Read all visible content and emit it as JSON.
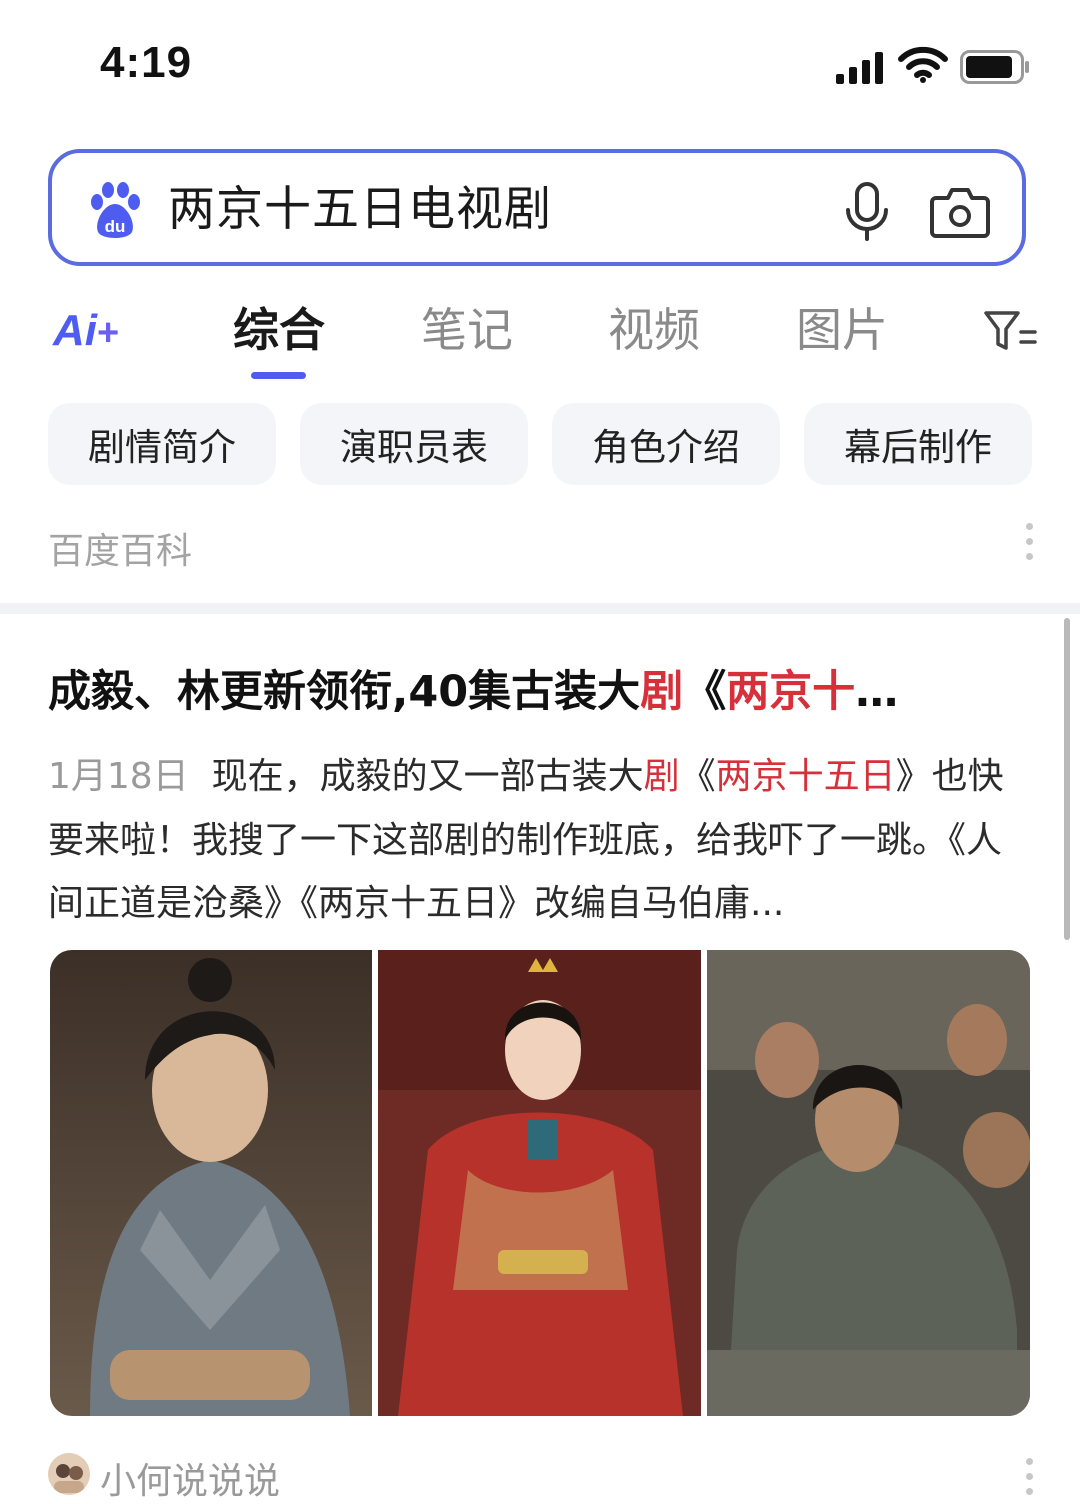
{
  "status_bar": {
    "time": "4:19"
  },
  "search": {
    "query": "两京十五日电视剧"
  },
  "tabs": {
    "ai_label": "Ai",
    "ai_plus": "+",
    "items": [
      "综合",
      "笔记",
      "视频",
      "图片"
    ],
    "active": "综合"
  },
  "chips": [
    "剧情简介",
    "演职员表",
    "角色介绍",
    "幕后制作"
  ],
  "source": {
    "label": "百度百科"
  },
  "result": {
    "title_plain": "成毅、林更新领衔,40集古装大",
    "title_hl1": "剧",
    "title_mid": "《",
    "title_hl2": "两京十",
    "title_end": "…",
    "date": "1月18日",
    "snippet_a": "现在，成毅的又一部古装大",
    "snippet_hl1": "剧",
    "snippet_b": "《",
    "snippet_hl2": "两京十五日",
    "snippet_c": "》也快要来啦！我搜了一下这部剧的制作班底，给我吓了一跳。《人间正道是沧桑》《两京十五日》改编自马伯庸..."
  },
  "author": {
    "name": "小何说说说"
  },
  "colors": {
    "accent": "#4e5df0",
    "highlight": "#d6303a",
    "muted": "#9a9a9a"
  }
}
